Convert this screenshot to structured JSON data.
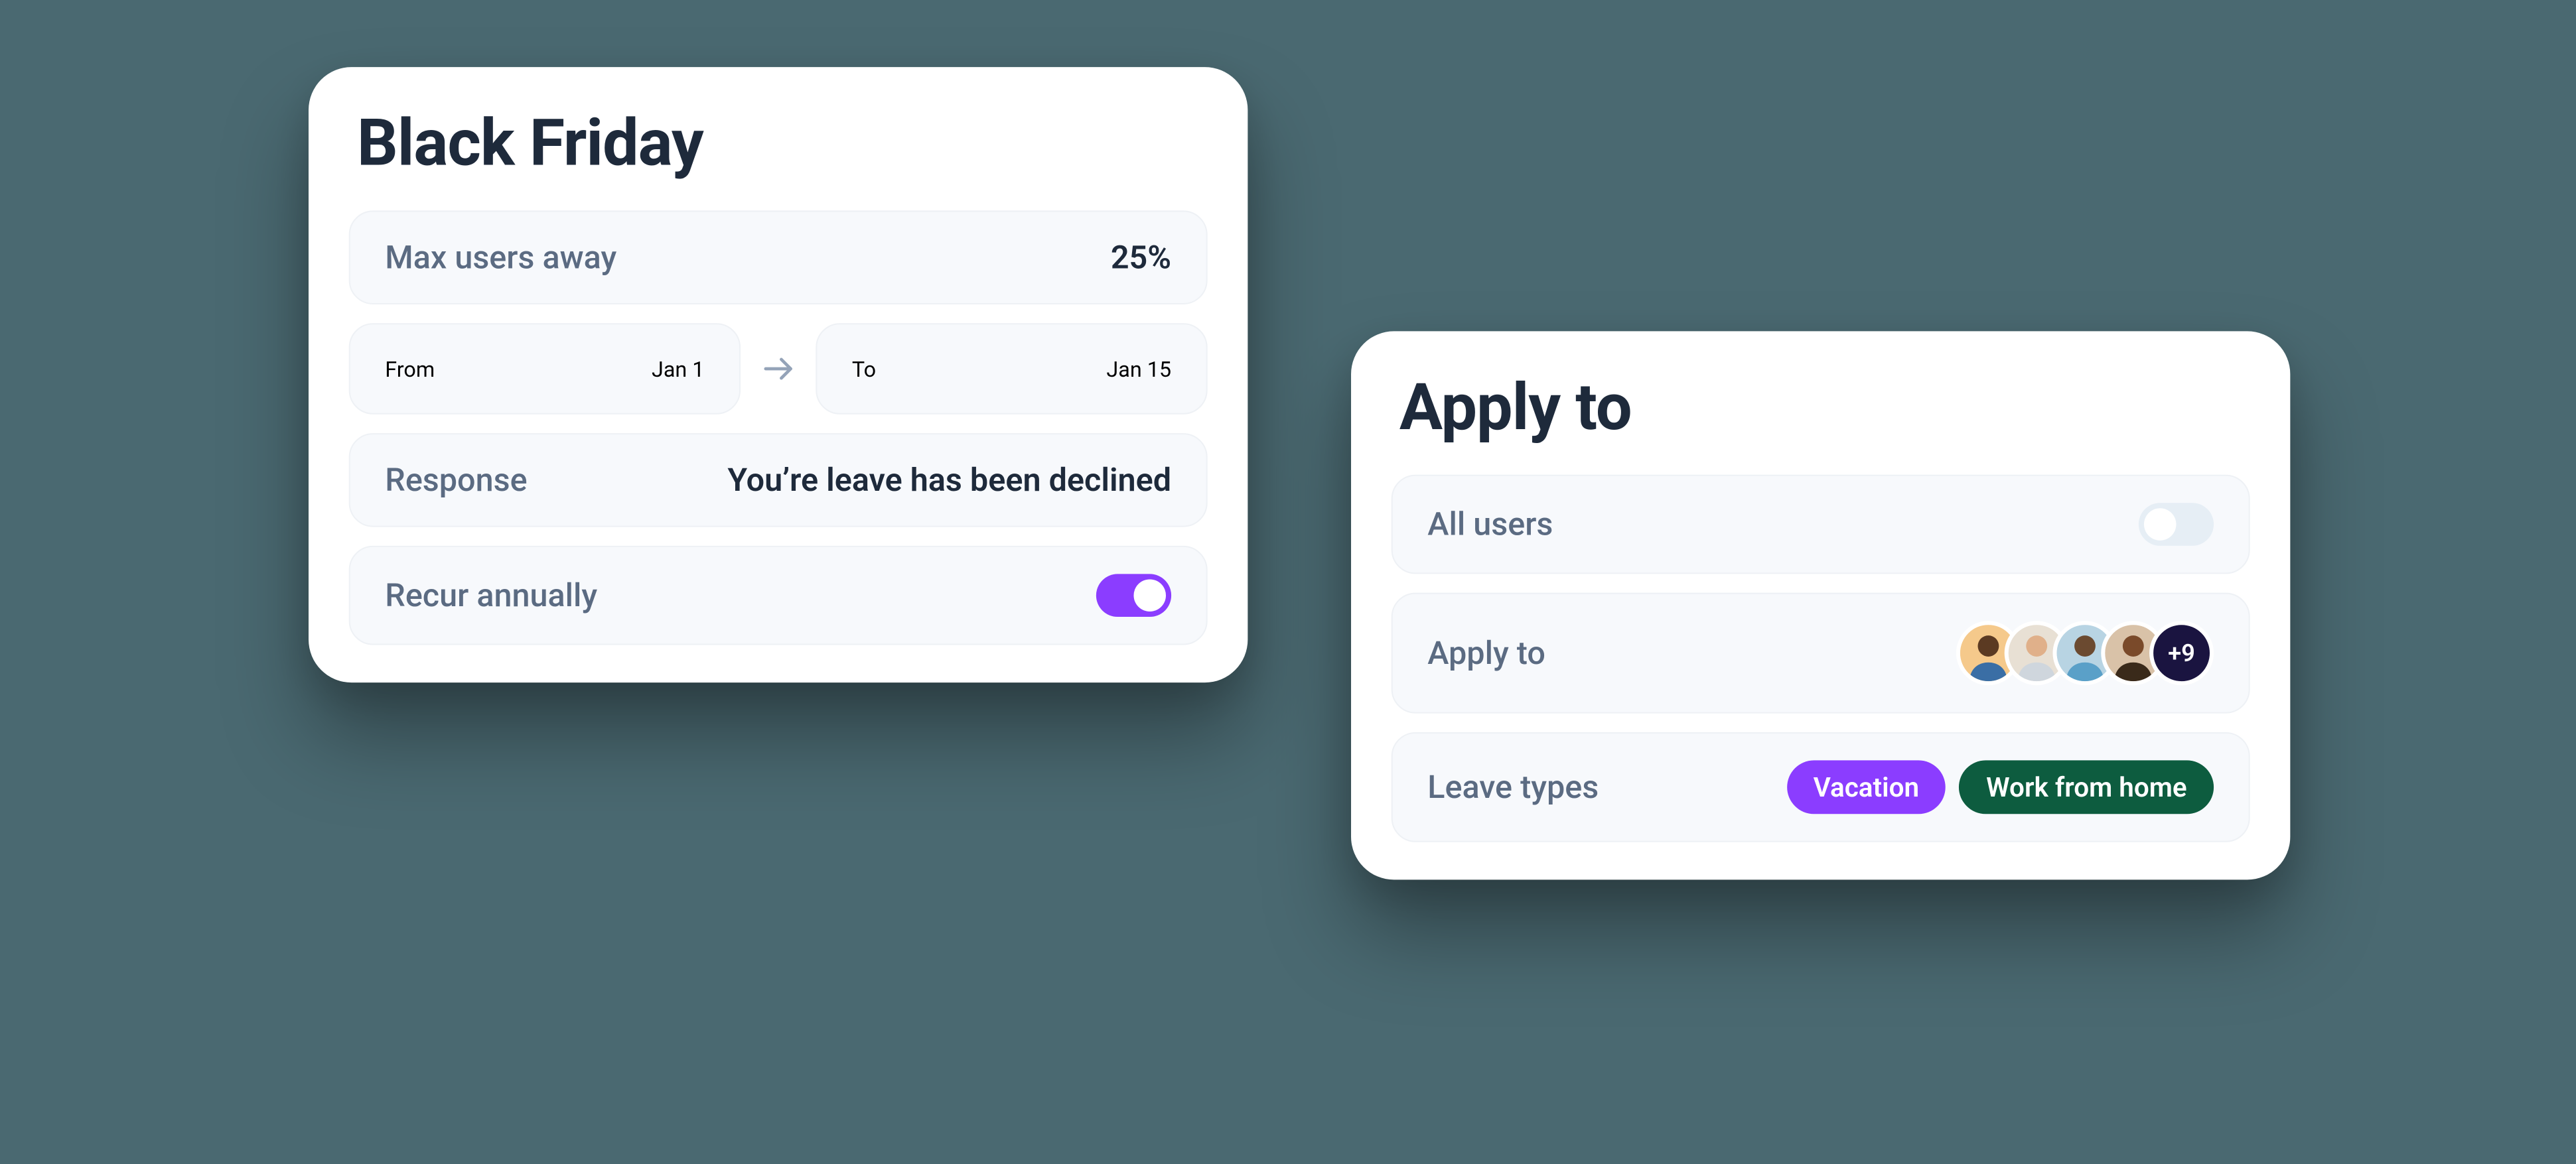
{
  "card_left": {
    "title": "Black Friday",
    "max_users_away": {
      "label": "Max users away",
      "value": "25%"
    },
    "from": {
      "label": "From",
      "value": "Jan 1"
    },
    "to": {
      "label": "To",
      "value": "Jan 15"
    },
    "response": {
      "label": "Response",
      "value": "You’re leave has been declined"
    },
    "recur": {
      "label": "Recur annually",
      "on": true
    }
  },
  "card_right": {
    "title": "Apply to",
    "all_users": {
      "label": "All users",
      "on": false
    },
    "apply_to": {
      "label": "Apply to",
      "overflow": "+9"
    },
    "leave_types": {
      "label": "Leave types",
      "chips": [
        {
          "text": "Vacation",
          "color": "purple"
        },
        {
          "text": "Work from home",
          "color": "green"
        }
      ]
    }
  },
  "colors": {
    "accent_purple": "#8b3dff",
    "accent_green": "#0d5c3f",
    "bg": "#4a6971"
  }
}
